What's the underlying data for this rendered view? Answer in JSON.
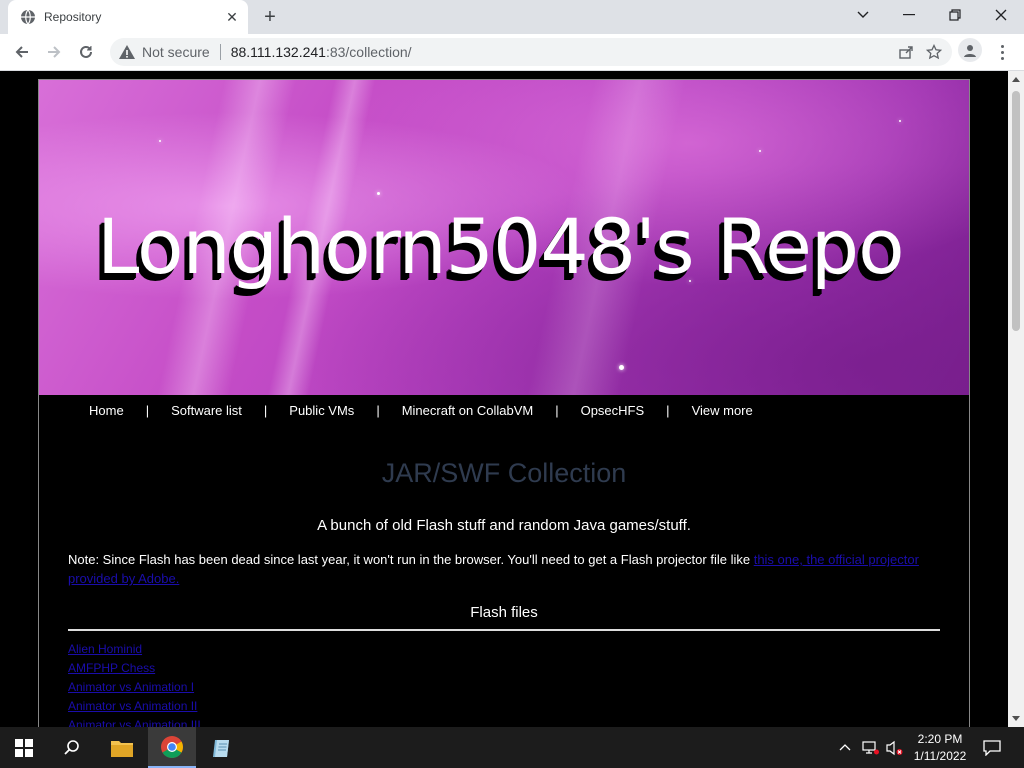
{
  "browser": {
    "tab_title": "Repository",
    "security_label": "Not secure",
    "url_host": "88.111.132.241",
    "url_path": ":83/collection/"
  },
  "page": {
    "banner_title": "Longhorn5048's Repo",
    "nav": [
      "Home",
      "Software list",
      "Public VMs",
      "Minecraft on CollabVM",
      "OpsecHFS",
      "View more"
    ],
    "heading": "JAR/SWF Collection",
    "subtitle": "A bunch of old Flash stuff and random Java games/stuff.",
    "note_text": "Note: Since Flash has been dead since last year, it won't run in the browser. You'll need to get a Flash projector file like ",
    "note_link": "this one, the official projector provided by Adobe.",
    "section_title": "Flash files",
    "flash_files": [
      "Alien Hominid",
      "AMFPHP Chess",
      "Animator vs Animation I",
      "Animator vs Animation II",
      "Animator vs Animation III"
    ]
  },
  "taskbar": {
    "time": "2:20 PM",
    "date": "1/11/2022"
  },
  "colors": {
    "heading": "#2f3b4f",
    "link": "#1a0dab",
    "banner_accent": "#c54dc7"
  }
}
